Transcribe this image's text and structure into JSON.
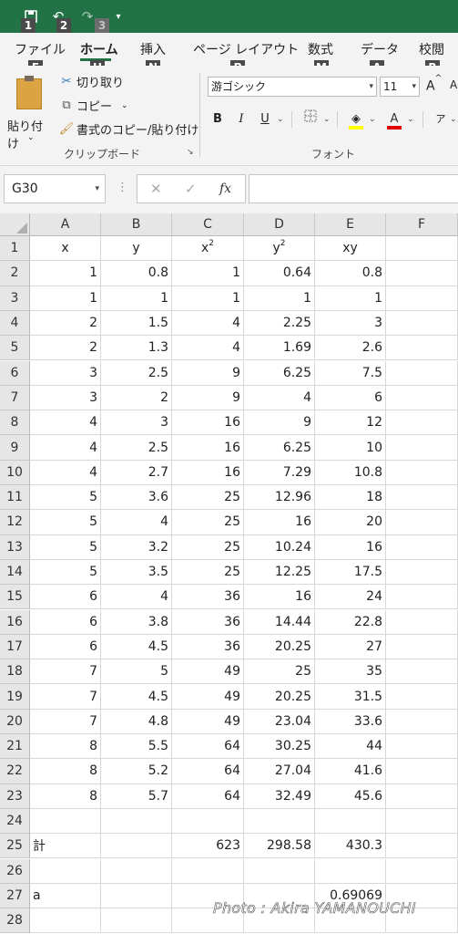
{
  "quick_access": {
    "keytips": [
      "1",
      "2",
      "3"
    ],
    "undo_icon": "undo-icon",
    "redo_icon": "redo-icon",
    "customize_icon": "customize-qat-icon"
  },
  "tabs": [
    {
      "label": "ファイル",
      "keytip": "F"
    },
    {
      "label": "ホーム",
      "keytip": "H",
      "active": true
    },
    {
      "label": "挿入",
      "keytip": "N"
    },
    {
      "label": "ページ レイアウト",
      "keytip": "P"
    },
    {
      "label": "数式",
      "keytip": "M"
    },
    {
      "label": "データ",
      "keytip": "A"
    },
    {
      "label": "校閲",
      "keytip": "R"
    }
  ],
  "ribbon": {
    "clipboard": {
      "paste_label": "貼り付け",
      "cut_label": "切り取り",
      "copy_label": "コピー",
      "format_painter_label": "書式のコピー/貼り付け",
      "group_label": "クリップボード"
    },
    "font": {
      "font_name": "游ゴシック",
      "font_size": "11",
      "grow_label": "A",
      "group_label": "フォント",
      "bold": "B",
      "italic": "I",
      "underline": "U",
      "font_color_label": "A",
      "accent_colors": {
        "highlight": "#ffff00",
        "font_color": "#e00000"
      }
    }
  },
  "formula_bar": {
    "name_box": "G30",
    "cancel_icon": "cancel-icon",
    "enter_icon": "enter-icon",
    "fx_label": "fx",
    "value": ""
  },
  "grid": {
    "columns": [
      "A",
      "B",
      "C",
      "D",
      "E",
      "F"
    ],
    "header_row": {
      "row": "1",
      "A": "x",
      "B": "y",
      "C": "x",
      "C_sup": "2",
      "D": "y",
      "D_sup": "2",
      "E": "xy"
    },
    "rows": [
      {
        "row": "2",
        "A": "1",
        "B": "0.8",
        "C": "1",
        "D": "0.64",
        "E": "0.8"
      },
      {
        "row": "3",
        "A": "1",
        "B": "1",
        "C": "1",
        "D": "1",
        "E": "1"
      },
      {
        "row": "4",
        "A": "2",
        "B": "1.5",
        "C": "4",
        "D": "2.25",
        "E": "3"
      },
      {
        "row": "5",
        "A": "2",
        "B": "1.3",
        "C": "4",
        "D": "1.69",
        "E": "2.6"
      },
      {
        "row": "6",
        "A": "3",
        "B": "2.5",
        "C": "9",
        "D": "6.25",
        "E": "7.5"
      },
      {
        "row": "7",
        "A": "3",
        "B": "2",
        "C": "9",
        "D": "4",
        "E": "6"
      },
      {
        "row": "8",
        "A": "4",
        "B": "3",
        "C": "16",
        "D": "9",
        "E": "12"
      },
      {
        "row": "9",
        "A": "4",
        "B": "2.5",
        "C": "16",
        "D": "6.25",
        "E": "10"
      },
      {
        "row": "10",
        "A": "4",
        "B": "2.7",
        "C": "16",
        "D": "7.29",
        "E": "10.8"
      },
      {
        "row": "11",
        "A": "5",
        "B": "3.6",
        "C": "25",
        "D": "12.96",
        "E": "18"
      },
      {
        "row": "12",
        "A": "5",
        "B": "4",
        "C": "25",
        "D": "16",
        "E": "20"
      },
      {
        "row": "13",
        "A": "5",
        "B": "3.2",
        "C": "25",
        "D": "10.24",
        "E": "16"
      },
      {
        "row": "14",
        "A": "5",
        "B": "3.5",
        "C": "25",
        "D": "12.25",
        "E": "17.5"
      },
      {
        "row": "15",
        "A": "6",
        "B": "4",
        "C": "36",
        "D": "16",
        "E": "24"
      },
      {
        "row": "16",
        "A": "6",
        "B": "3.8",
        "C": "36",
        "D": "14.44",
        "E": "22.8"
      },
      {
        "row": "17",
        "A": "6",
        "B": "4.5",
        "C": "36",
        "D": "20.25",
        "E": "27"
      },
      {
        "row": "18",
        "A": "7",
        "B": "5",
        "C": "49",
        "D": "25",
        "E": "35"
      },
      {
        "row": "19",
        "A": "7",
        "B": "4.5",
        "C": "49",
        "D": "20.25",
        "E": "31.5"
      },
      {
        "row": "20",
        "A": "7",
        "B": "4.8",
        "C": "49",
        "D": "23.04",
        "E": "33.6"
      },
      {
        "row": "21",
        "A": "8",
        "B": "5.5",
        "C": "64",
        "D": "30.25",
        "E": "44"
      },
      {
        "row": "22",
        "A": "8",
        "B": "5.2",
        "C": "64",
        "D": "27.04",
        "E": "41.6"
      },
      {
        "row": "23",
        "A": "8",
        "B": "5.7",
        "C": "64",
        "D": "32.49",
        "E": "45.6"
      },
      {
        "row": "24",
        "A": "",
        "B": "",
        "C": "",
        "D": "",
        "E": ""
      },
      {
        "row": "25",
        "A": "計",
        "B": "",
        "C": "623",
        "D": "298.58",
        "E": "430.3"
      },
      {
        "row": "26",
        "A": "",
        "B": "",
        "C": "",
        "D": "",
        "E": ""
      },
      {
        "row": "27",
        "A": "a",
        "B": "",
        "C": "",
        "D": "",
        "E": "0.69069"
      },
      {
        "row": "28",
        "A": "",
        "B": "",
        "C": "",
        "D": "",
        "E": ""
      }
    ]
  },
  "watermark": "Photo : Akira YAMANOUCHI",
  "colors": {
    "excel_green": "#217346",
    "ribbon_bg": "#f3f3f3",
    "header_bg": "#e6e6e6"
  }
}
